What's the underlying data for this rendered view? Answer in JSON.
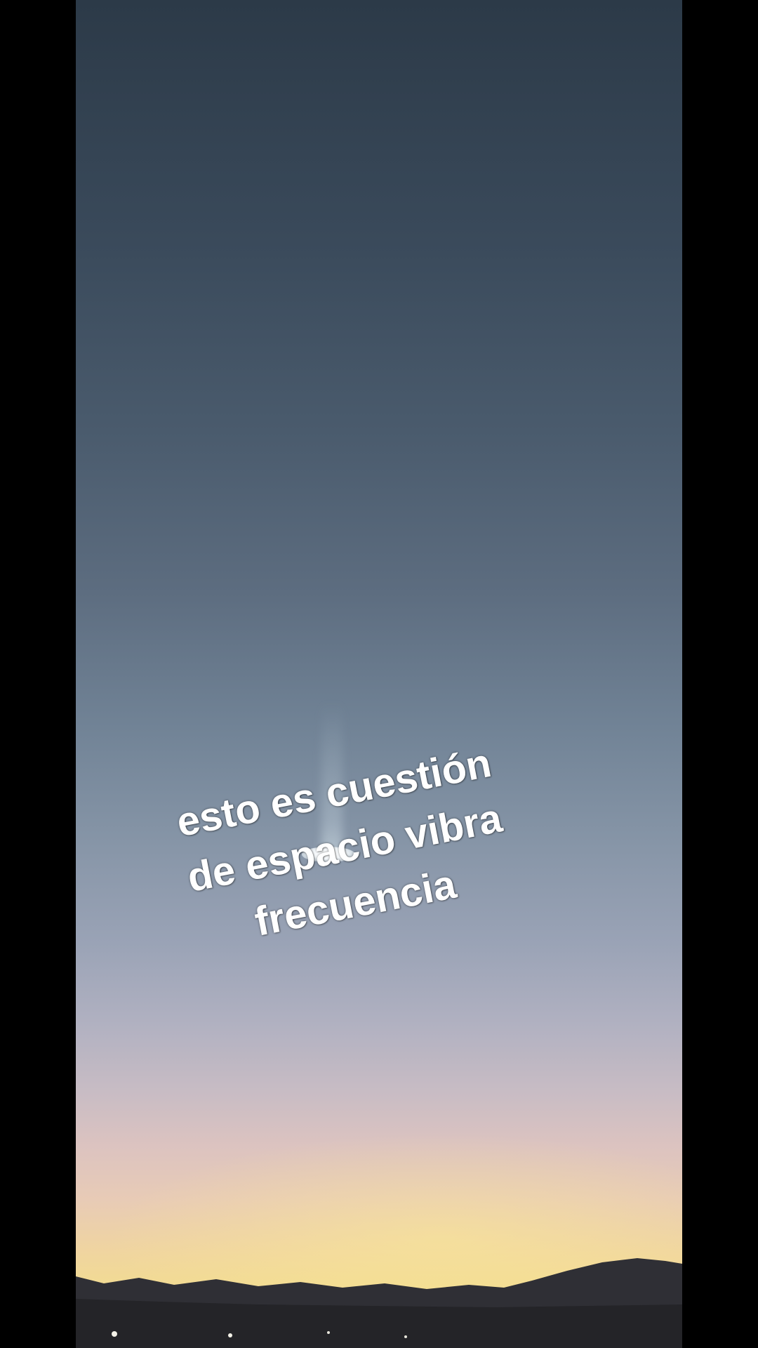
{
  "caption": {
    "line1": "esto es cuestión",
    "line2": "de espacio vibra",
    "line3": "frecuencia"
  },
  "colors": {
    "letterbox": "#000000",
    "sky_top": "#2c3a48",
    "sky_horizon": "#f2dc90",
    "mountains": "#2f2f35",
    "caption_text": "#ffffff"
  }
}
